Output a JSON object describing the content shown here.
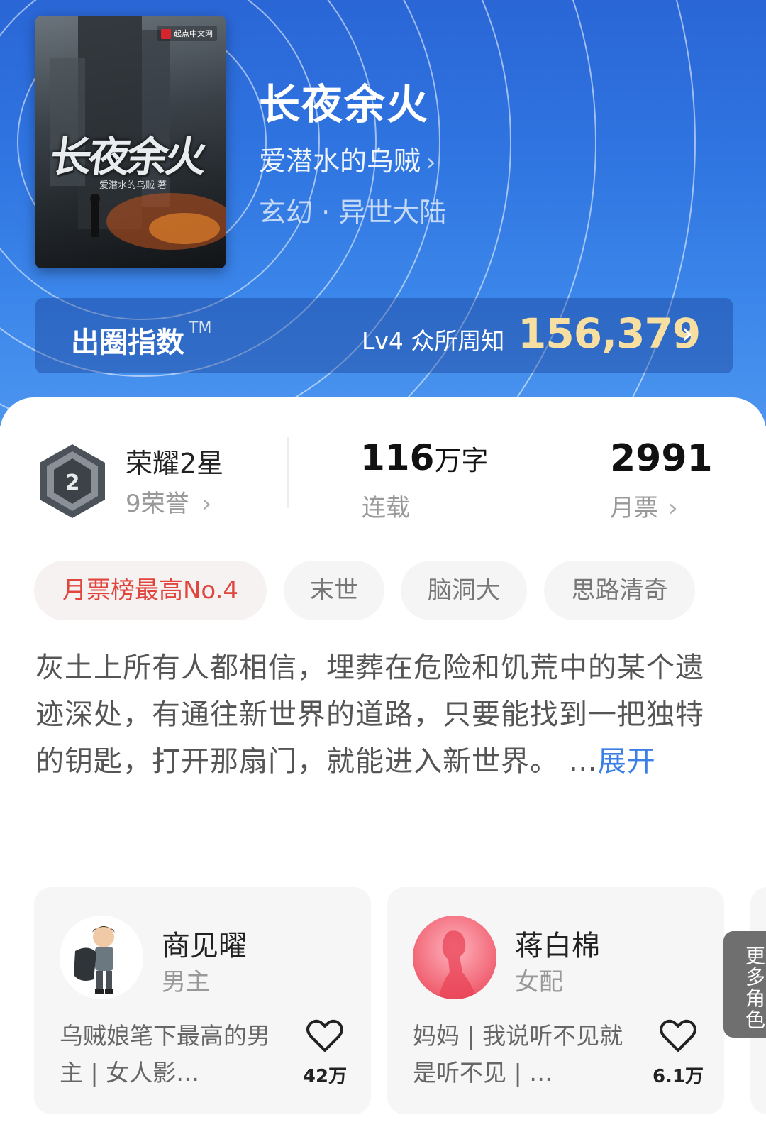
{
  "book": {
    "title": "长夜余火",
    "author": "爱潜水的乌贼",
    "author_chevron": "›",
    "genre": "玄幻 · 异世大陆",
    "cover": {
      "title": "长夜余火",
      "author_line": "爱潜水的乌贼 著",
      "publisher_logo": "起点中文网"
    }
  },
  "breakout_index": {
    "label": "出圈指数",
    "tm": "TM",
    "level": "Lv4 众所周知",
    "value": "156,379",
    "chevron": "›"
  },
  "stats": {
    "honor_title": "荣耀2星",
    "honor_sub": "9荣誉",
    "honor_chevron": "›",
    "words_value": "116",
    "words_unit": "万字",
    "words_status": "连载",
    "votes_value": "2991",
    "votes_label": "月票",
    "votes_chevron": "›"
  },
  "tags": [
    {
      "label": "月票榜最高No.4",
      "highlight": true
    },
    {
      "label": "末世"
    },
    {
      "label": "脑洞大"
    },
    {
      "label": "思路清奇"
    }
  ],
  "synopsis": {
    "text": "灰土上所有人都相信，埋葬在危险和饥荒中的某个遗迹深处，有通往新世界的道路，只要能找到一把独特的钥匙，打开那扇门，就能进入新世界。",
    "ellipsis": " …",
    "expand": "展开"
  },
  "characters": [
    {
      "name": "商见曜",
      "role": "男主",
      "desc": "乌贼娘笔下最高的男主 | 女人影…",
      "likes": "42万",
      "icon": "heart-icon"
    },
    {
      "name": "蒋白棉",
      "role": "女配",
      "desc": "妈妈 | 我说听不见就是听不见 | …",
      "likes": "6.1万",
      "icon": "heart-icon"
    }
  ],
  "more_characters": "更多角色",
  "colors": {
    "header_blue": "#2f74e0",
    "index_gold": "#f6dfa0",
    "rank_red": "#e0453e",
    "link_blue": "#3b7fe6"
  }
}
